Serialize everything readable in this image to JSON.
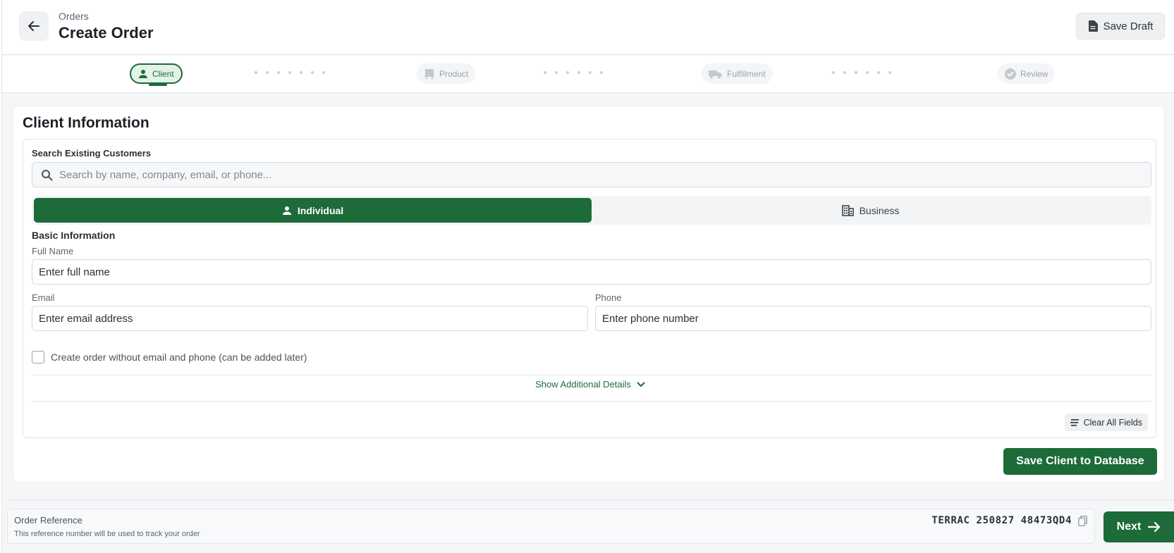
{
  "header": {
    "breadcrumb": "Orders",
    "title": "Create Order",
    "save_draft_label": "Save Draft"
  },
  "stepper": {
    "steps": [
      {
        "label": "Client",
        "icon": "person-icon",
        "state": "active"
      },
      {
        "label": "Product",
        "icon": "cart-icon",
        "state": "inactive"
      },
      {
        "label": "Fulfillment",
        "icon": "truck-icon",
        "state": "inactive"
      },
      {
        "label": "Review",
        "icon": "check-circle-icon",
        "state": "inactive"
      }
    ]
  },
  "client": {
    "title": "Client Information",
    "search": {
      "label": "Search Existing Customers",
      "placeholder": "Search by name, company, email, or phone...",
      "value": ""
    },
    "type_toggle": {
      "options": [
        "Individual",
        "Business"
      ],
      "selected": "Individual"
    },
    "basic_info_label": "Basic Information",
    "full_name": {
      "label": "Full Name",
      "placeholder": "Enter full name",
      "value": ""
    },
    "email": {
      "label": "Email",
      "placeholder": "Enter email address",
      "value": ""
    },
    "phone": {
      "label": "Phone",
      "placeholder": "Enter phone number",
      "value": ""
    },
    "no_contact_checkbox": {
      "label": "Create order without email and phone (can be added later)",
      "checked": false
    },
    "show_more_label": "Show Additional Details",
    "clear_label": "Clear All Fields",
    "save_client_label": "Save Client to Database"
  },
  "footer": {
    "ref_title": "Order Reference",
    "ref_desc": "This reference number will be used to track your order",
    "ref_code": "TERRAC 250827 48473QD4",
    "next_label": "Next"
  },
  "colors": {
    "accent": "#1c6b39",
    "accent_light": "#e3f3e6",
    "background": "#f5f6f7"
  }
}
